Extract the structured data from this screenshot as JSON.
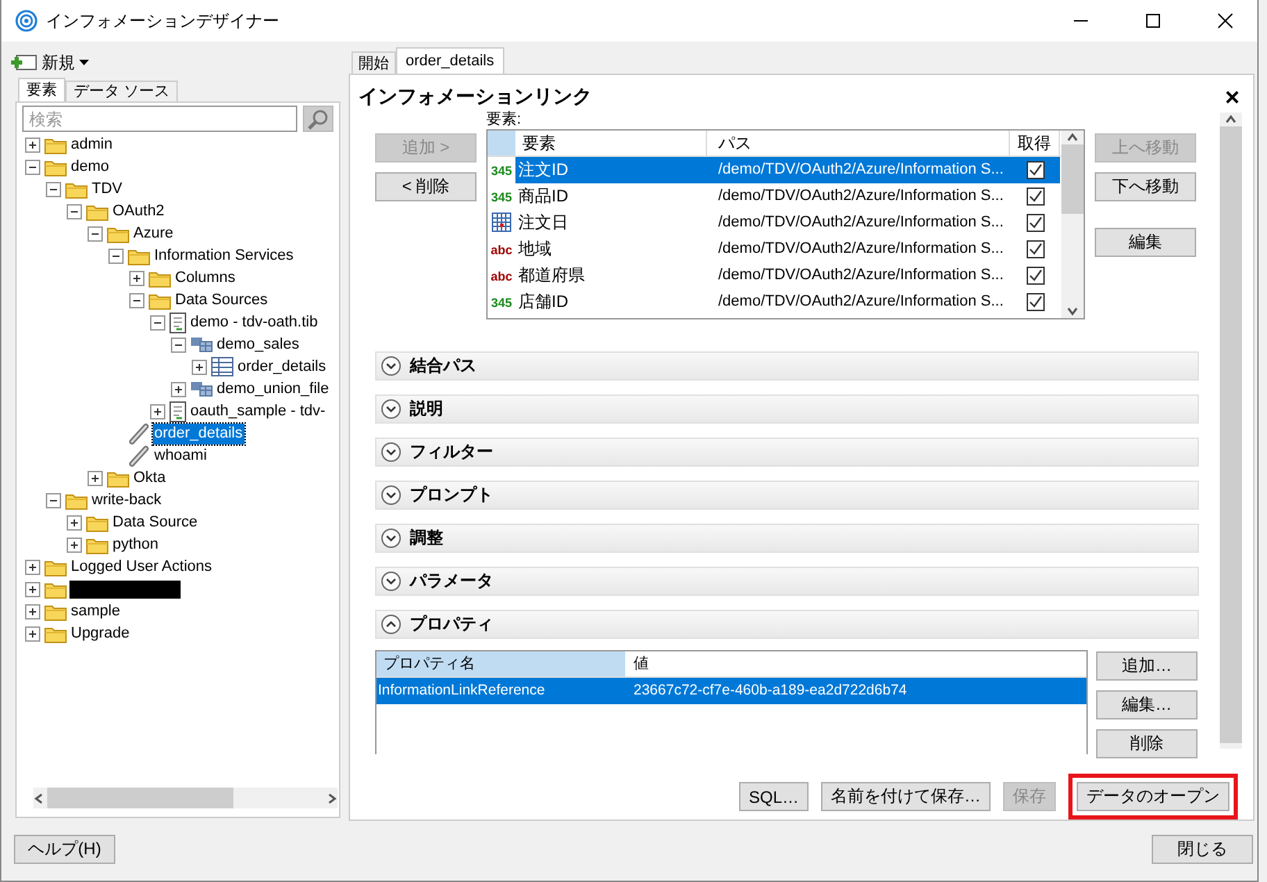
{
  "window": {
    "title": "インフォメーションデザイナー"
  },
  "left_panel": {
    "new_button": "新規",
    "tabs": [
      {
        "label": "要素",
        "selected": true
      },
      {
        "label": "データ ソース",
        "selected": false
      }
    ],
    "search": {
      "placeholder": "検索"
    },
    "tree": [
      {
        "label": "admin",
        "kind": "folder",
        "expanded": false,
        "selected": false
      },
      {
        "label": "demo",
        "kind": "folder",
        "expanded": true,
        "selected": false,
        "children": [
          {
            "label": "TDV",
            "kind": "folder",
            "expanded": true,
            "selected": false,
            "children": [
              {
                "label": "OAuth2",
                "kind": "folder",
                "expanded": true,
                "selected": false,
                "children": [
                  {
                    "label": "Azure",
                    "kind": "folder",
                    "expanded": true,
                    "selected": false,
                    "children": [
                      {
                        "label": "Information Services",
                        "kind": "folder",
                        "expanded": true,
                        "selected": false,
                        "children": [
                          {
                            "label": "Columns",
                            "kind": "folder",
                            "expanded": false,
                            "selected": false
                          },
                          {
                            "label": "Data Sources",
                            "kind": "folder",
                            "expanded": true,
                            "selected": false,
                            "children": [
                              {
                                "label": "demo - tdv-oath.tib",
                                "kind": "file",
                                "expanded": true,
                                "selected": false,
                                "children": [
                                  {
                                    "label": "demo_sales",
                                    "kind": "schema",
                                    "expanded": true,
                                    "selected": false,
                                    "children": [
                                      {
                                        "label": "order_details",
                                        "kind": "table",
                                        "expanded": false,
                                        "selected": false
                                      }
                                    ]
                                  },
                                  {
                                    "label": "demo_union_file",
                                    "kind": "schema",
                                    "expanded": false,
                                    "selected": false
                                  }
                                ]
                              },
                              {
                                "label": "oauth_sample - tdv-",
                                "kind": "file",
                                "expanded": false,
                                "selected": false
                              }
                            ]
                          }
                        ]
                      },
                      {
                        "label": "order_details",
                        "kind": "link",
                        "selected": true
                      },
                      {
                        "label": "whoami",
                        "kind": "link",
                        "selected": false
                      }
                    ]
                  },
                  {
                    "label": "Okta",
                    "kind": "folder",
                    "expanded": false,
                    "selected": false
                  }
                ]
              }
            ]
          },
          {
            "label": "write-back",
            "kind": "folder",
            "expanded": true,
            "selected": false,
            "children": [
              {
                "label": "Data Source",
                "kind": "folder",
                "expanded": false,
                "selected": false
              },
              {
                "label": "python",
                "kind": "folder",
                "expanded": false,
                "selected": false
              }
            ]
          }
        ]
      },
      {
        "label": "Logged User Actions",
        "kind": "folder",
        "expanded": false,
        "selected": false
      },
      {
        "kind": "folder",
        "redacted": true,
        "expanded": false,
        "selected": false
      },
      {
        "label": "sample",
        "kind": "folder",
        "expanded": false,
        "selected": false
      },
      {
        "label": "Upgrade",
        "kind": "folder",
        "expanded": false,
        "selected": false
      }
    ],
    "help_button": "ヘルプ(H)"
  },
  "editor_tabs": [
    {
      "label": "開始",
      "selected": false
    },
    {
      "label": "order_details",
      "selected": true
    }
  ],
  "info_link": {
    "title": "インフォメーションリンク",
    "close": "×",
    "left_buttons": [
      {
        "label": "追加 >",
        "disabled": true
      },
      {
        "label": "< 削除",
        "disabled": false
      }
    ],
    "elements_label": "要素:",
    "columns": [
      "要素",
      "パス",
      "取得"
    ],
    "rows": [
      {
        "kind": "integer",
        "badge": "345",
        "name": "注文ID",
        "path": "/demo/TDV/OAuth2/Azure/Information S...",
        "checked": true,
        "selected": true
      },
      {
        "kind": "integer",
        "badge": "345",
        "name": "商品ID",
        "path": "/demo/TDV/OAuth2/Azure/Information S...",
        "checked": true,
        "selected": false
      },
      {
        "kind": "date",
        "name": "注文日",
        "path": "/demo/TDV/OAuth2/Azure/Information S...",
        "checked": true,
        "selected": false
      },
      {
        "kind": "string",
        "badge": "abc",
        "name": "地域",
        "path": "/demo/TDV/OAuth2/Azure/Information S...",
        "checked": true,
        "selected": false
      },
      {
        "kind": "string",
        "badge": "abc",
        "name": "都道府県",
        "path": "/demo/TDV/OAuth2/Azure/Information S...",
        "checked": true,
        "selected": false
      },
      {
        "kind": "integer",
        "badge": "345",
        "name": "店舗ID",
        "path": "/demo/TDV/OAuth2/Azure/Information S...",
        "checked": true,
        "selected": false
      }
    ],
    "right_buttons": [
      {
        "label": "上へ移動",
        "disabled": true
      },
      {
        "label": "下へ移動",
        "disabled": false
      },
      {
        "label": "編集",
        "disabled": false
      }
    ],
    "sections": [
      {
        "label": "結合パス",
        "expanded": false
      },
      {
        "label": "説明",
        "expanded": false
      },
      {
        "label": "フィルター",
        "expanded": false
      },
      {
        "label": "プロンプト",
        "expanded": false
      },
      {
        "label": "調整",
        "expanded": false
      },
      {
        "label": "パラメータ",
        "expanded": false
      },
      {
        "label": "プロパティ",
        "expanded": true
      }
    ],
    "properties": {
      "columns": [
        "プロパティ名",
        "値"
      ],
      "rows": [
        {
          "name": "InformationLinkReference",
          "value": "23667c72-cf7e-460b-a189-ea2d722d6b74",
          "selected": true
        }
      ],
      "buttons": [
        {
          "label": "追加…",
          "disabled": false
        },
        {
          "label": "編集…",
          "disabled": false
        },
        {
          "label": "削除",
          "disabled": false
        }
      ]
    },
    "footer_buttons": [
      {
        "label": "SQL…",
        "disabled": false,
        "highlighted": false
      },
      {
        "label": "名前を付けて保存…",
        "disabled": false,
        "highlighted": false
      },
      {
        "label": "保存",
        "disabled": true,
        "highlighted": false
      },
      {
        "label": "データのオープン",
        "disabled": false,
        "highlighted": true
      }
    ]
  },
  "close_button": "閉じる"
}
